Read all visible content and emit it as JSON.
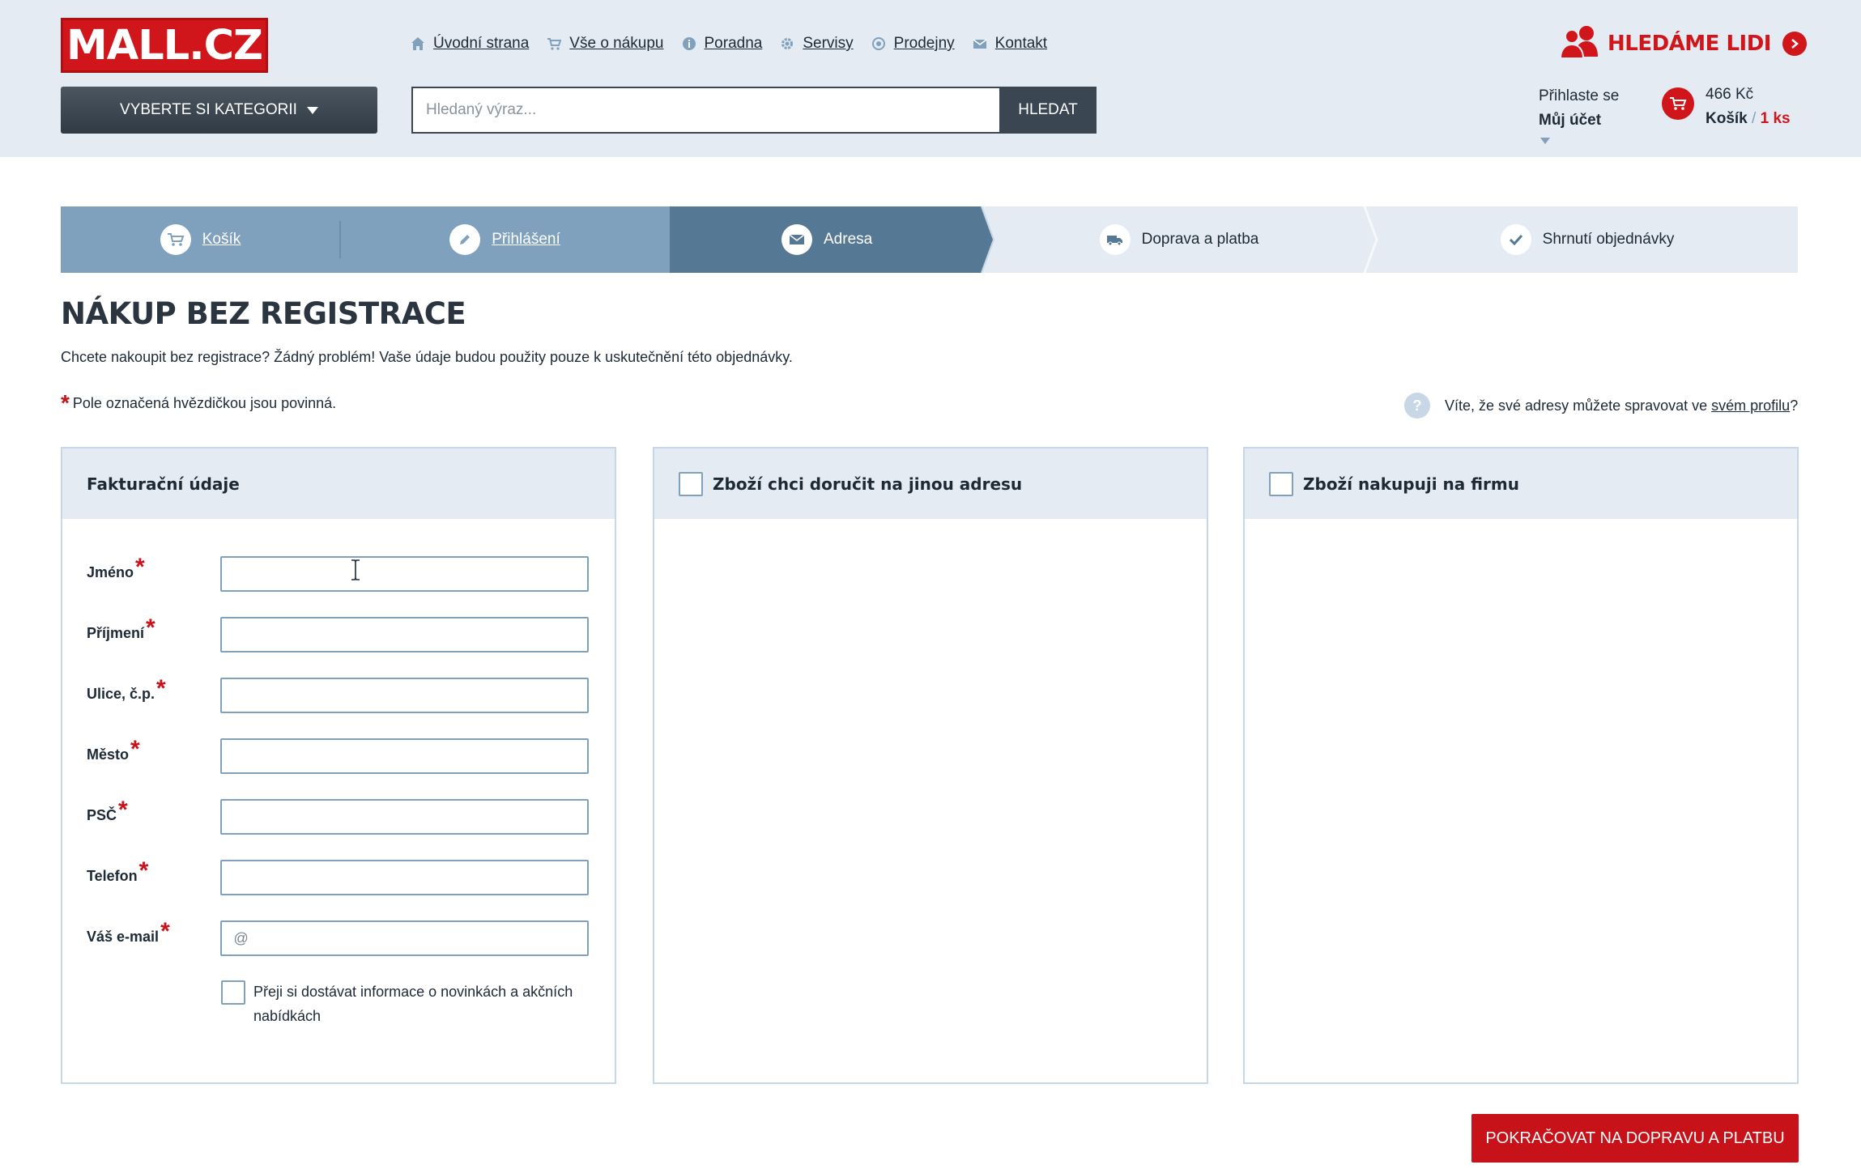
{
  "header": {
    "logo_text": "MALL.CZ",
    "nav": [
      {
        "label": "Úvodní strana",
        "icon": "home-icon"
      },
      {
        "label": "Vše o nákupu",
        "icon": "cart-icon"
      },
      {
        "label": "Poradna",
        "icon": "info-icon"
      },
      {
        "label": "Servisy",
        "icon": "gear-icon"
      },
      {
        "label": "Prodejny",
        "icon": "location-icon"
      },
      {
        "label": "Kontakt",
        "icon": "envelope-icon"
      }
    ],
    "hiring_label": "HLEDÁME LIDI",
    "category_button": "VYBERTE SI KATEGORII",
    "search_placeholder": "Hledaný výraz...",
    "search_button": "HLEDAT",
    "account": {
      "line1": "Přihlaste se",
      "line2": "Můj účet"
    },
    "cart": {
      "price": "466 Kč",
      "label": "Košík",
      "separator": "/",
      "count": "1 ks"
    }
  },
  "steps": [
    {
      "label": "Košík",
      "state": "done",
      "icon": "cart-icon"
    },
    {
      "label": "Přihlášení",
      "state": "done",
      "icon": "pencil-icon"
    },
    {
      "label": "Adresa",
      "state": "active",
      "icon": "envelope-icon"
    },
    {
      "label": "Doprava a platba",
      "state": "todo",
      "icon": "truck-icon"
    },
    {
      "label": "Shrnutí objednávky",
      "state": "todo",
      "icon": "check-icon"
    }
  ],
  "page": {
    "title": "NÁKUP BEZ REGISTRACE",
    "intro": "Chcete nakoupit bez registrace? Žádný problém! Vaše údaje budou použity pouze k uskutečnění této objednávky.",
    "required_note": "Pole označená hvězdičkou jsou povinná.",
    "tip_prefix": "Víte, že své adresy můžete spravovat ve ",
    "tip_link": "svém profilu",
    "tip_suffix": "?"
  },
  "billing": {
    "heading": "Fakturační údaje",
    "fields": [
      {
        "label": "Jméno",
        "value": "",
        "placeholder": ""
      },
      {
        "label": "Příjmení",
        "value": "",
        "placeholder": ""
      },
      {
        "label": "Ulice, č.p.",
        "value": "",
        "placeholder": ""
      },
      {
        "label": "Město",
        "value": "",
        "placeholder": ""
      },
      {
        "label": "PSČ",
        "value": "",
        "placeholder": ""
      },
      {
        "label": "Telefon",
        "value": "",
        "placeholder": ""
      },
      {
        "label": "Váš e-mail",
        "value": "",
        "placeholder": "@"
      }
    ],
    "required_mark": "*",
    "newsletter_label": "Přeji si dostávat informace o novinkách a akčních nabídkách",
    "newsletter_checked": false
  },
  "delivery": {
    "heading": "Zboží chci doručit na jinou adresu",
    "checked": false
  },
  "company": {
    "heading": "Zboží nakupuji na firmu",
    "checked": false
  },
  "continue_button": "POKRAČOVAT NA DOPRAVU A PLATBU",
  "colors": {
    "brand": "#d0161b",
    "header_bg": "#e4ebf2",
    "step_done": "#7fa1bd",
    "step_active": "#557895",
    "step_todo": "#e4ebf2"
  }
}
